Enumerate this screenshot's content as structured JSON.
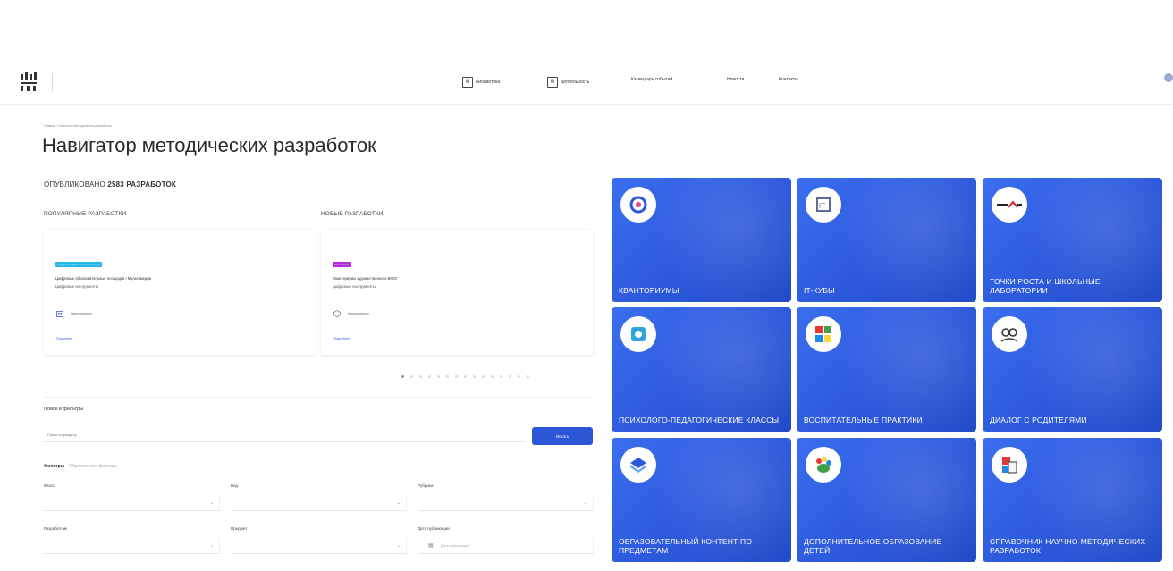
{
  "header": {
    "logo_text": "",
    "nav": [
      {
        "label": "Библиотека"
      },
      {
        "label": "Деятельность"
      },
      {
        "label": "Календарь событий"
      },
      {
        "label": "Новости"
      },
      {
        "label": "Контакты"
      }
    ]
  },
  "breadcrumb": "Главная / Навигатор методических разработок",
  "page_title": "Навигатор методических разработок",
  "published": {
    "prefix": "ОПУБЛИКОВАНО",
    "count": "2583",
    "suffix": "РАЗРАБОТОК"
  },
  "popular": {
    "title": "ПОПУЛЯРНЫЕ РАЗРАБОТКИ",
    "badge": "Цифровая образовательная среда",
    "badge_color": "#22b7e8",
    "card_title": "Цифровые образовательные площадки / Мультимедиа",
    "card_type": "Цифровые инструменты",
    "meta": "Кванторианцы",
    "link": "Подробнее"
  },
  "new": {
    "title": "НОВЫЕ РАЗРАБОТКИ",
    "badge": "Кванториум",
    "badge_color": "#b62bd8",
    "card_title": "Кванториумы художественного ВКОУ",
    "card_type": "Цифровые инструменты",
    "meta": "Кванторианцы",
    "link": "Подробнее"
  },
  "carousel": {
    "total": 15,
    "active": 0
  },
  "search": {
    "title": "Поиск и фильтры",
    "placeholder": "Поиск по разделу",
    "button": "Искать"
  },
  "filters": {
    "title": "Фильтры",
    "reset": "Сбросить все фильтры",
    "fields": [
      {
        "label": "Класс",
        "placeholder": ""
      },
      {
        "label": "Вид",
        "placeholder": ""
      },
      {
        "label": "Рубрика",
        "placeholder": ""
      },
      {
        "label": "Разработчик",
        "placeholder": ""
      },
      {
        "label": "Предмет",
        "placeholder": ""
      },
      {
        "label": "Дата публикации",
        "placeholder": "Дата публикации"
      }
    ]
  },
  "tiles": [
    {
      "label": "КВАНТОРИУМЫ",
      "icon": "kvantorium-logo-icon"
    },
    {
      "label": "IT-КУБЫ",
      "icon": "it-cube-logo-icon"
    },
    {
      "label": "ТОЧКИ РОСТА И ШКОЛЬНЫЕ ЛАБОРАТОРИИ",
      "icon": "tochki-rosta-logo-icon"
    },
    {
      "label": "ПСИХОЛОГО-ПЕДАГОГИЧЕСКИЕ КЛАССЫ",
      "icon": "psychology-classes-logo-icon"
    },
    {
      "label": "ВОСПИТАТЕЛЬНЫЕ ПРАКТИКИ",
      "icon": "education-practices-logo-icon"
    },
    {
      "label": "ДИАЛОГ С РОДИТЕЛЯМИ",
      "icon": "dialog-parents-logo-icon"
    },
    {
      "label": "ОБРАЗОВАТЕЛЬНЫЙ КОНТЕНТ ПО ПРЕДМЕТАМ",
      "icon": "edu-content-logo-icon"
    },
    {
      "label": "ДОПОЛНИТЕЛЬНОЕ ОБРАЗОВАНИЕ ДЕТЕЙ",
      "icon": "additional-education-logo-icon"
    },
    {
      "label": "СПРАВОЧНИК НАУЧНО-МЕТОДИЧЕСКИХ РАЗРАБОТОК",
      "icon": "handbook-logo-icon"
    }
  ],
  "colors": {
    "accent": "#2d56d6",
    "tile_blue": "#2c58db"
  }
}
